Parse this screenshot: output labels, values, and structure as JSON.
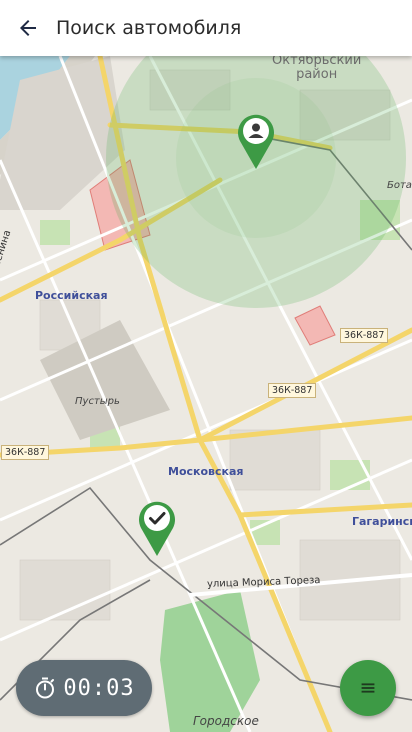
{
  "appbar": {
    "title": "Поиск автомобиля",
    "back_icon": "arrow-back-icon"
  },
  "map": {
    "districts": [
      "Октябрьский",
      "район"
    ],
    "partial_labels": [
      "Бота"
    ],
    "stations": [
      "Российская",
      "Московская",
      "Гагаринск"
    ],
    "streets": [
      "ул Ленина",
      "улица Мориса Тореза"
    ],
    "areas": [
      "Пустырь",
      "Городское"
    ],
    "road_badges": [
      "36К-887",
      "36К-887",
      "36К-887"
    ],
    "search_radius_color": "#4caf50",
    "user_marker_icon": "person-pin-icon",
    "car_marker_icon": "check-pin-icon",
    "marker_color": "#3d9a45"
  },
  "timer": {
    "icon": "timer-icon",
    "value": "00:03"
  },
  "fab": {
    "icon": "menu-icon"
  }
}
